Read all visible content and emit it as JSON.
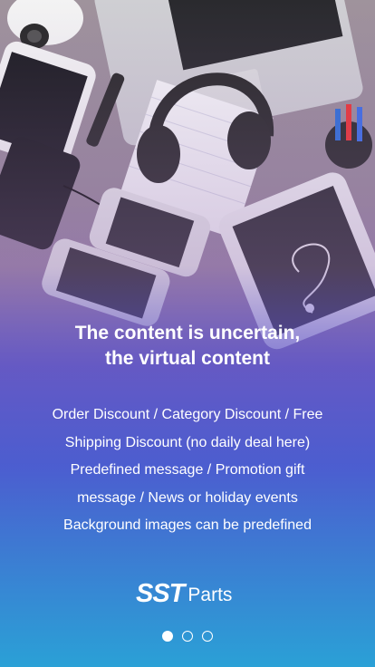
{
  "headline": {
    "line1": "The content is uncertain,",
    "line2": "the virtual content"
  },
  "body": {
    "lines": [
      "Order Discount / Category Discount / Free",
      "Shipping Discount (no daily deal here)",
      "Predefined message / Promotion gift",
      "message / News or holiday events",
      "Background images can be predefined"
    ]
  },
  "logo": {
    "mark": "SST",
    "word": "Parts"
  },
  "pager": {
    "count": 3,
    "active_index": 0
  },
  "colors": {
    "top_background": "#9c8f99",
    "mid_purple": "#6d5ec8",
    "bottom_cyan": "#2fa9d8",
    "text": "#ffffff"
  }
}
